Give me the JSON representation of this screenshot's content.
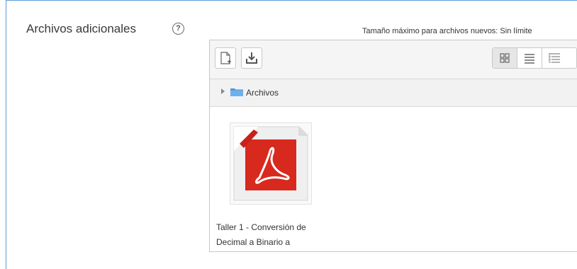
{
  "field": {
    "label": "Archivos adicionales",
    "help_glyph": "?",
    "help_icon": "question-circle-icon"
  },
  "filepicker": {
    "max_size_text": "Tamaño máximo para archivos nuevos: Sin límite",
    "toolbar": {
      "add_icon": "add-file-icon",
      "download_icon": "download-icon",
      "views": [
        "view-icons-icon",
        "view-list-icon",
        "view-tree-icon"
      ],
      "active_view": "view-icons-icon"
    },
    "path": {
      "label": "Archivos"
    },
    "files": [
      {
        "name": "Taller 1 - Conversión de Decimal a Binario a",
        "type_icon": "pdf-file-icon"
      }
    ]
  },
  "colors": {
    "frame_border": "#5b9bd5",
    "pdf_red": "#d8291e",
    "folder_blue": "#4a90d9"
  }
}
